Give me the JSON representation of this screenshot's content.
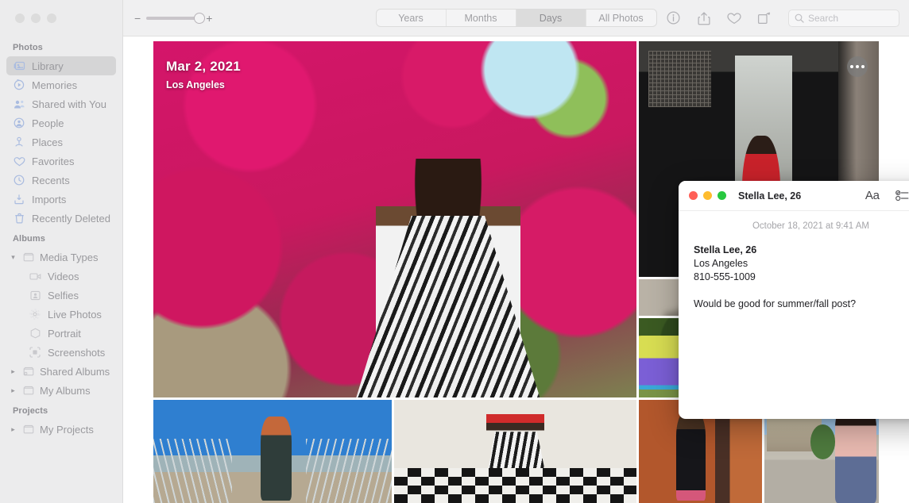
{
  "window": {
    "traffic_lights": [
      "close",
      "minimize",
      "zoom"
    ]
  },
  "toolbar": {
    "zoom_minus": "−",
    "zoom_plus": "+",
    "segments": [
      {
        "label": "Years",
        "active": false
      },
      {
        "label": "Months",
        "active": false
      },
      {
        "label": "Days",
        "active": true
      },
      {
        "label": "All Photos",
        "active": false
      }
    ],
    "actions": [
      {
        "name": "info-icon",
        "label": "Info"
      },
      {
        "name": "share-icon",
        "label": "Share"
      },
      {
        "name": "favorite-icon",
        "label": "Favorite"
      },
      {
        "name": "rotate-icon",
        "label": "Rotate"
      }
    ],
    "search": {
      "placeholder": "Search",
      "value": "",
      "icon": "search-icon"
    }
  },
  "sidebar": {
    "sections": [
      {
        "header": "Photos",
        "items": [
          {
            "label": "Library",
            "icon": "library-icon",
            "selected": true
          },
          {
            "label": "Memories",
            "icon": "memories-icon",
            "selected": false
          },
          {
            "label": "Shared with You",
            "icon": "shared-with-you-icon",
            "selected": false
          },
          {
            "label": "People",
            "icon": "people-icon",
            "selected": false
          },
          {
            "label": "Places",
            "icon": "places-icon",
            "selected": false
          },
          {
            "label": "Favorites",
            "icon": "heart-icon",
            "selected": false
          },
          {
            "label": "Recents",
            "icon": "clock-icon",
            "selected": false
          },
          {
            "label": "Imports",
            "icon": "import-icon",
            "selected": false
          },
          {
            "label": "Recently Deleted",
            "icon": "trash-icon",
            "selected": false
          }
        ]
      },
      {
        "header": "Albums",
        "items": [
          {
            "label": "Media Types",
            "icon": "folder-icon",
            "disclosure": "expanded"
          },
          {
            "label": "Videos",
            "icon": "video-icon",
            "indent": true
          },
          {
            "label": "Selfies",
            "icon": "selfie-icon",
            "indent": true
          },
          {
            "label": "Live Photos",
            "icon": "live-photo-icon",
            "indent": true
          },
          {
            "label": "Portrait",
            "icon": "portrait-icon",
            "indent": true
          },
          {
            "label": "Screenshots",
            "icon": "screenshot-icon",
            "indent": true
          },
          {
            "label": "Shared Albums",
            "icon": "shared-folder-icon",
            "disclosure": "collapsed"
          },
          {
            "label": "My Albums",
            "icon": "folder-icon",
            "disclosure": "collapsed"
          }
        ]
      },
      {
        "header": "Projects",
        "items": [
          {
            "label": "My Projects",
            "icon": "folder-icon",
            "disclosure": "collapsed"
          }
        ]
      }
    ]
  },
  "grid": {
    "hero": {
      "date": "Mar 2, 2021",
      "location": "Los Angeles",
      "more_button": "more-options"
    }
  },
  "note": {
    "title": "Stella Lee, 26",
    "traffic_lights": [
      "close",
      "minimize",
      "zoom"
    ],
    "actions": [
      {
        "name": "format-button",
        "label": "Aa"
      },
      {
        "name": "checklist-icon",
        "label": "Checklist"
      },
      {
        "name": "expand-chevron-icon",
        "label": "»"
      }
    ],
    "date": "October 18, 2021 at 9:41 AM",
    "lines": [
      "Stella Lee, 26",
      "Los Angeles",
      "810-555-1009",
      "Would be good for summer/fall post?"
    ]
  }
}
